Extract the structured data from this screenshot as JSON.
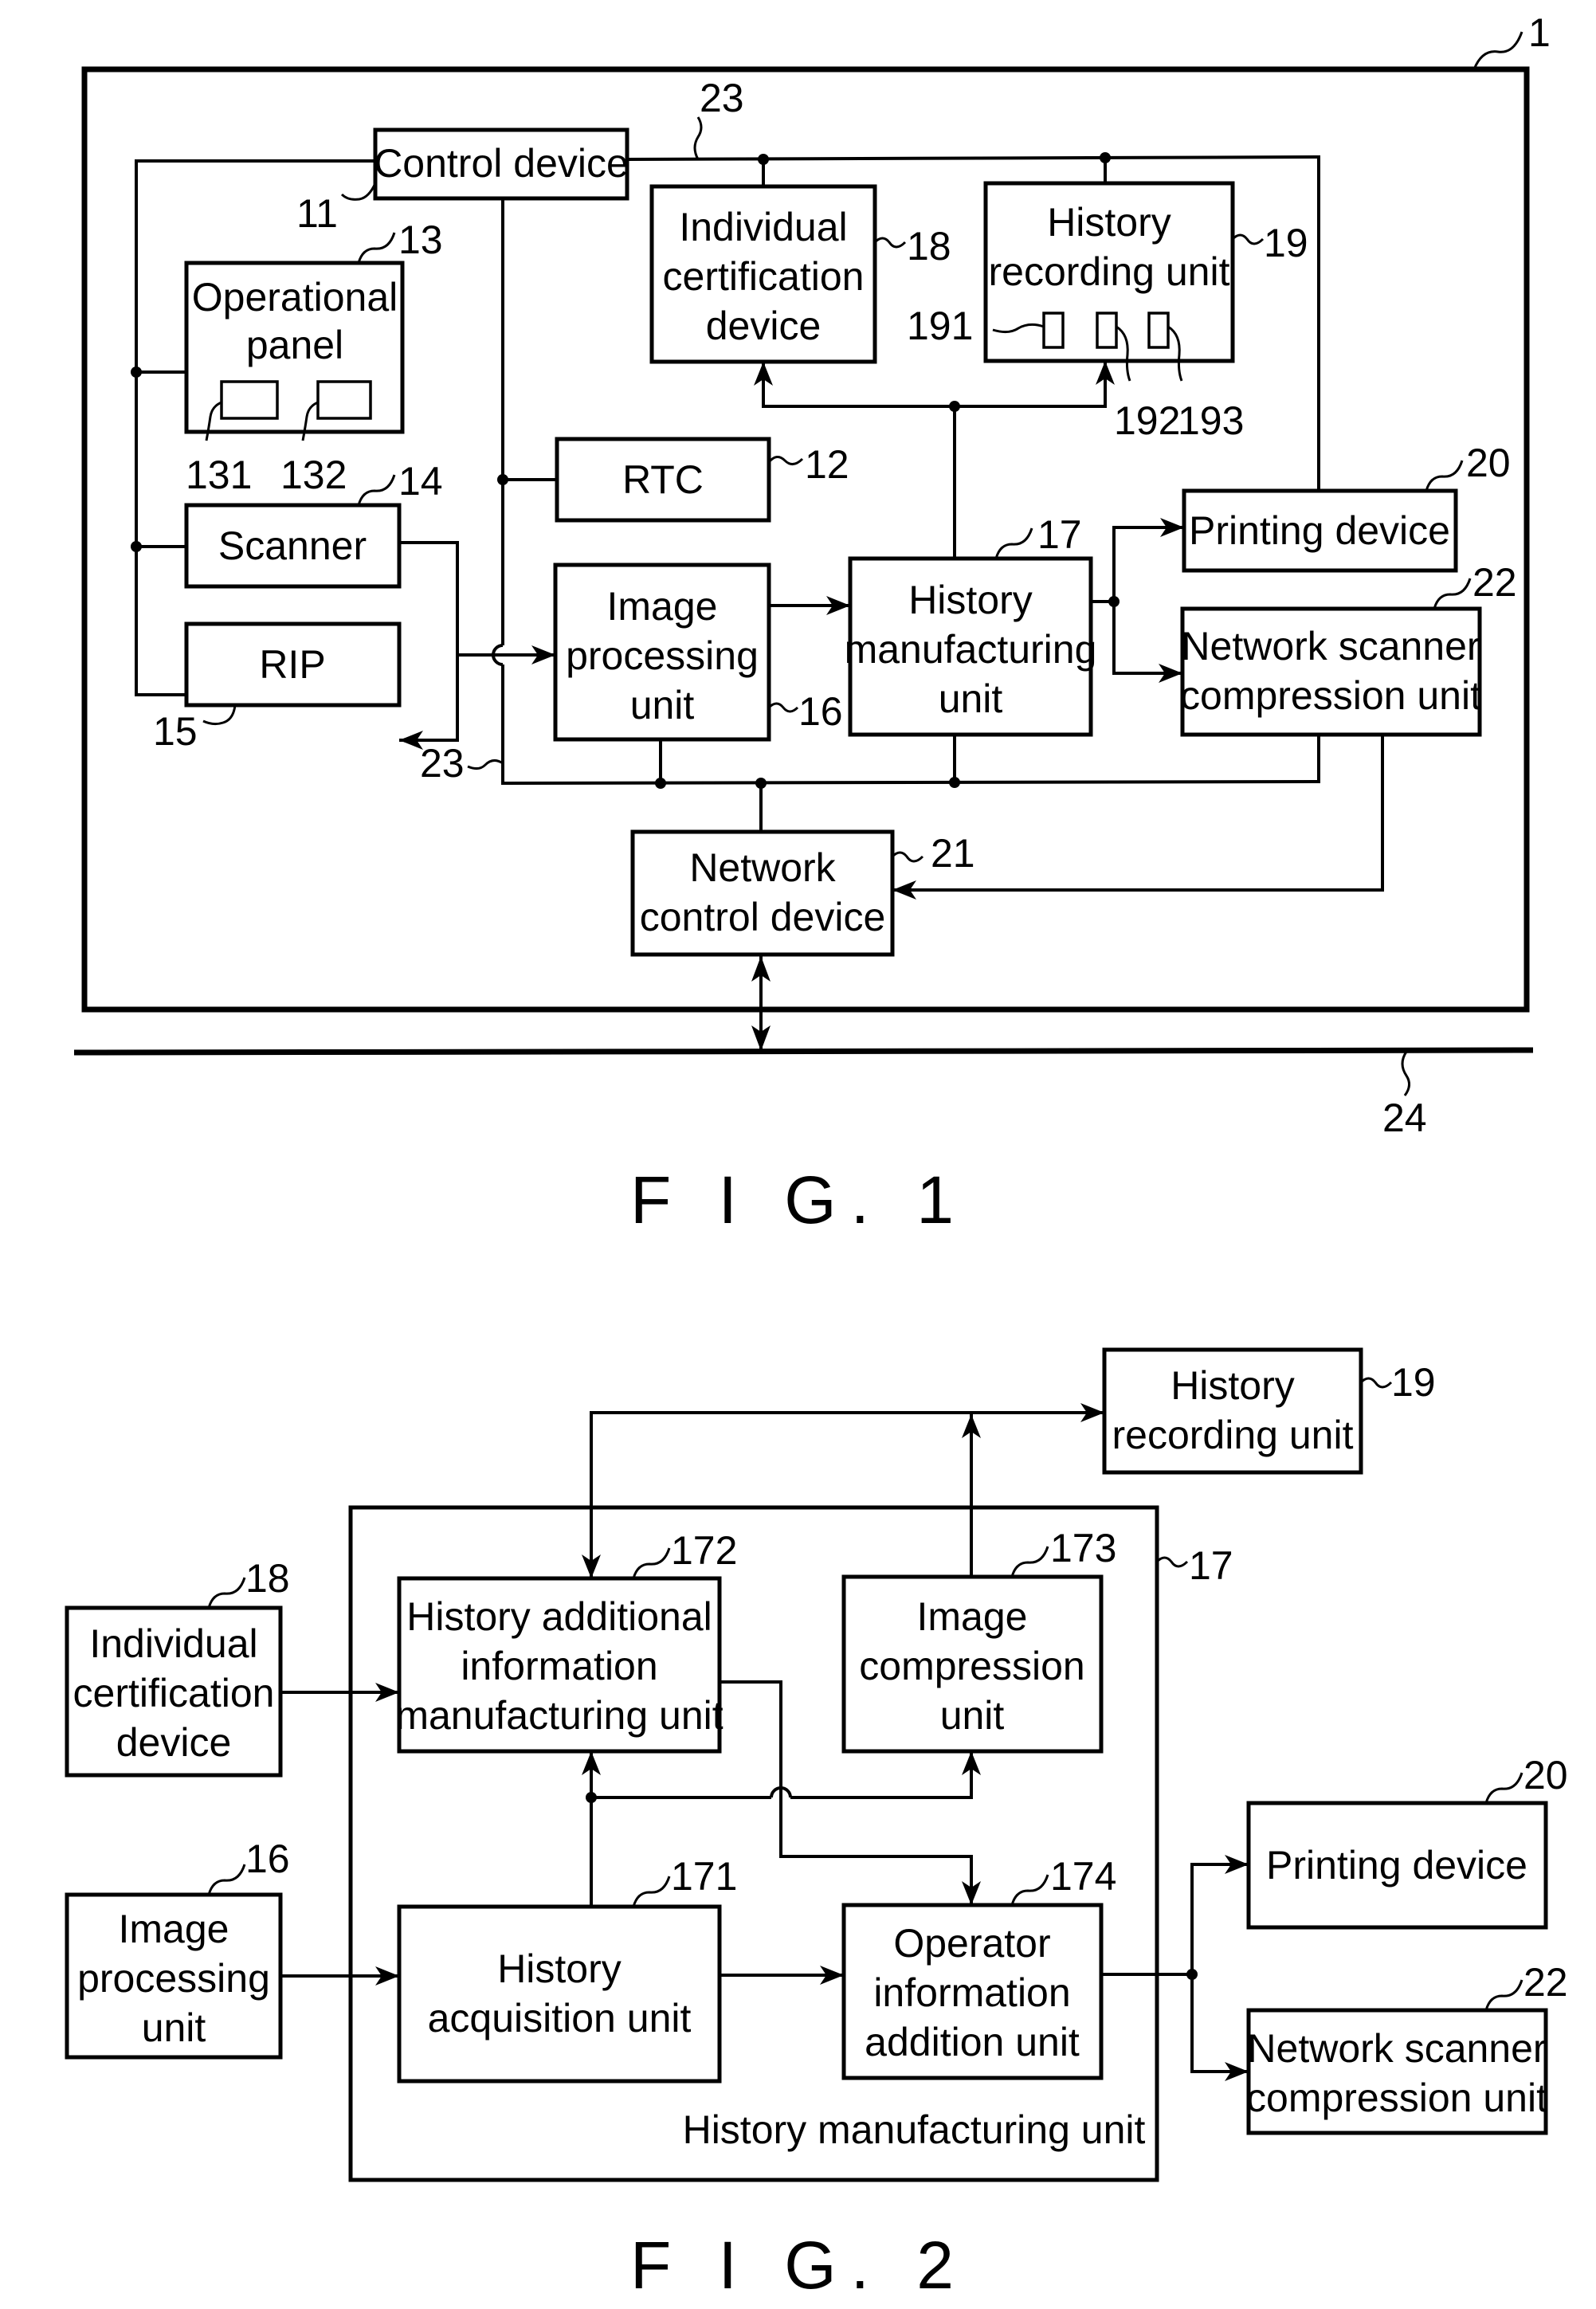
{
  "fig1": {
    "caption": "F I G. 1",
    "blocks": {
      "control_device": {
        "ref": "11",
        "lines": [
          "Control device"
        ]
      },
      "rtc": {
        "ref": "12",
        "lines": [
          "RTC"
        ]
      },
      "operational_panel": {
        "ref": "13",
        "lines": [
          "Operational",
          "panel"
        ],
        "sub_refs": [
          "131",
          "132"
        ]
      },
      "scanner": {
        "ref": "14",
        "lines": [
          "Scanner"
        ]
      },
      "rip": {
        "ref": "15",
        "lines": [
          "RIP"
        ]
      },
      "image_processing": {
        "ref": "16",
        "lines": [
          "Image",
          "processing",
          "unit"
        ]
      },
      "history_manufacturing": {
        "ref": "17",
        "lines": [
          "History",
          "manufacturing",
          "unit"
        ]
      },
      "individual_certification": {
        "ref": "18",
        "lines": [
          "Individual",
          "certification",
          "device"
        ]
      },
      "history_recording": {
        "ref": "19",
        "lines": [
          "History",
          "recording unit"
        ],
        "sub_refs": [
          "191",
          "192",
          "193"
        ]
      },
      "printing_device": {
        "ref": "20",
        "lines": [
          "Printing device"
        ]
      },
      "network_control": {
        "ref": "21",
        "lines": [
          "Network",
          "control device"
        ]
      },
      "network_scanner": {
        "ref": "22",
        "lines": [
          "Network scanner",
          "compression unit"
        ]
      }
    },
    "refs": {
      "apparatus": "1",
      "bus_top": "23",
      "bus_bottom": "23",
      "network": "24"
    }
  },
  "fig2": {
    "caption": "F I G. 2",
    "container": {
      "ref": "17",
      "label": "History manufacturing unit"
    },
    "blocks": {
      "history_recording": {
        "ref": "19",
        "lines": [
          "History",
          "recording unit"
        ]
      },
      "individual_certification": {
        "ref": "18",
        "lines": [
          "Individual",
          "certification",
          "device"
        ]
      },
      "image_processing": {
        "ref": "16",
        "lines": [
          "Image",
          "processing",
          "unit"
        ]
      },
      "history_additional": {
        "ref": "172",
        "lines": [
          "History additional",
          "information",
          "manufacturing unit"
        ]
      },
      "image_compression": {
        "ref": "173",
        "lines": [
          "Image",
          "compression",
          "unit"
        ]
      },
      "history_acquisition": {
        "ref": "171",
        "lines": [
          "History",
          "acquisition unit"
        ]
      },
      "operator_information": {
        "ref": "174",
        "lines": [
          "Operator",
          "information",
          "addition unit"
        ]
      },
      "printing_device": {
        "ref": "20",
        "lines": [
          "Printing device"
        ]
      },
      "network_scanner": {
        "ref": "22",
        "lines": [
          "Network scanner",
          "compression unit"
        ]
      }
    }
  }
}
